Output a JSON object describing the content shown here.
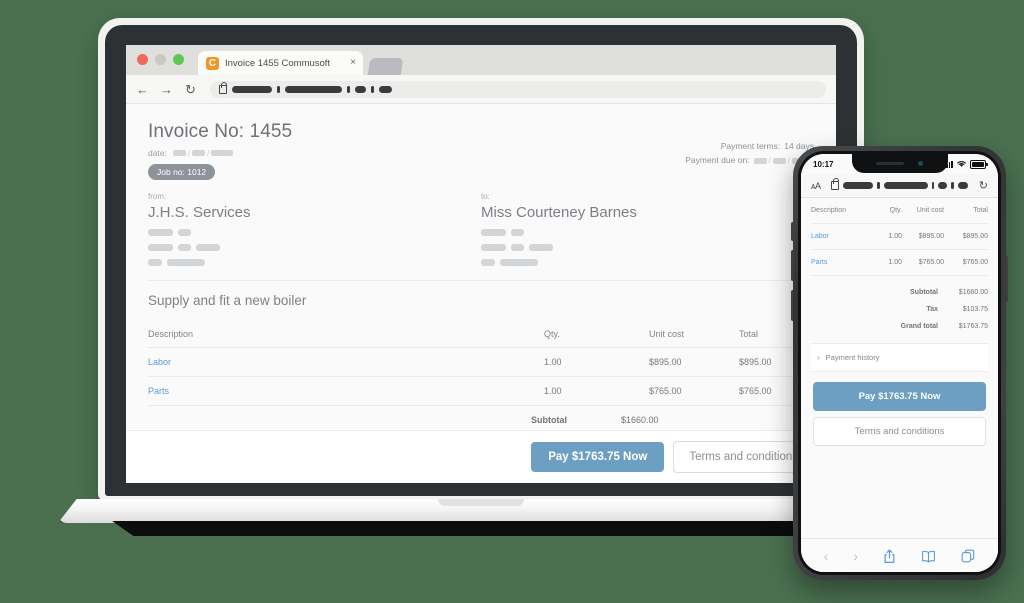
{
  "browser": {
    "tab": {
      "title": "Invoice 1455 Commusoft",
      "favicon_letter": "C",
      "favicon_color": "#f0962c",
      "close_label": "×"
    },
    "nav": {
      "back": "←",
      "forward": "→",
      "reload": "↻"
    },
    "url_redacted": true
  },
  "invoice": {
    "number_label": "Invoice No: 1455",
    "date_label": "date:",
    "job_no": "Job no: 1012",
    "payment_terms_label": "Payment terms:",
    "payment_terms_value": "14 days",
    "payment_due_label": "Payment due on:",
    "from_label": "from:",
    "from_name": "J.H.S. Services",
    "to_label": "to:",
    "to_name": "Miss Courteney Barnes",
    "job_title": "Supply and fit a new boiler",
    "columns": {
      "description": "Description",
      "qty": "Qty.",
      "unit_cost": "Unit cost",
      "total": "Total"
    },
    "rows": [
      {
        "description": "Labor",
        "qty": "1.00",
        "unit_cost": "$895.00",
        "total": "$895.00"
      },
      {
        "description": "Parts",
        "qty": "1.00",
        "unit_cost": "$765.00",
        "total": "$765.00"
      }
    ],
    "totals": [
      {
        "label": "Subtotal",
        "value": "$1660.00"
      },
      {
        "label": "Tax",
        "value": "$103.75"
      },
      {
        "label": "Grand total",
        "value": "$1763.75"
      }
    ],
    "payment_history_label": "Payment history",
    "payment_history_chevron": "›",
    "pay_button": "Pay $1763.75 Now",
    "terms_button": "Terms and conditions",
    "accent_color": "#6d9fc2",
    "link_color": "#5b9bd5"
  },
  "phone": {
    "status_time": "10:17",
    "safari_text_size": "ᴀA",
    "reload": "↻",
    "toolbar": {
      "back": "‹",
      "forward": "›"
    }
  }
}
